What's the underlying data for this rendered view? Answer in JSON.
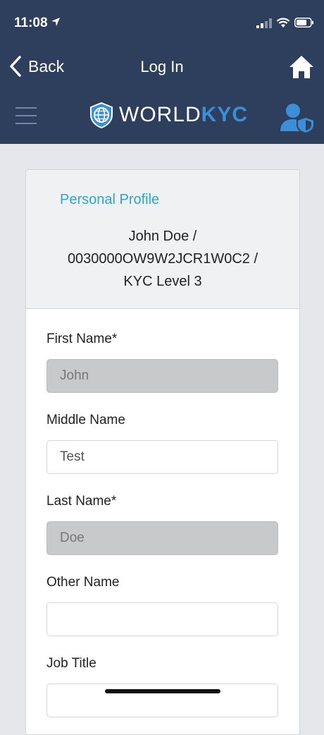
{
  "status_bar": {
    "time": "11:08",
    "icons": [
      "location-arrow-icon",
      "cellular-signal-icon",
      "wifi-icon",
      "battery-icon"
    ]
  },
  "nav": {
    "back_label": "Back",
    "title": "Log In",
    "home_icon": "home-icon"
  },
  "brand": {
    "logo_word": "WORLD",
    "logo_accent": "KYC",
    "menu_icon": "hamburger-menu-icon",
    "user_icon": "user-shield-icon"
  },
  "colors": {
    "header_bg": "#2e3e5d",
    "accent_blue": "#3a8fd8",
    "section_title": "#2aa7c9",
    "disabled_field": "#c8c9cb"
  },
  "profile": {
    "section_title": "Personal Profile",
    "info_line1": "John Doe /",
    "info_line2": "0030000OW9W2JCR1W0C2 /",
    "info_line3": "KYC Level 3"
  },
  "form": {
    "first_name": {
      "label": "First Name*",
      "value": "John"
    },
    "middle_name": {
      "label": "Middle Name",
      "value": "Test"
    },
    "last_name": {
      "label": "Last Name*",
      "value": "Doe"
    },
    "other_name": {
      "label": "Other Name",
      "value": ""
    },
    "job_title": {
      "label": "Job Title",
      "value": ""
    }
  }
}
